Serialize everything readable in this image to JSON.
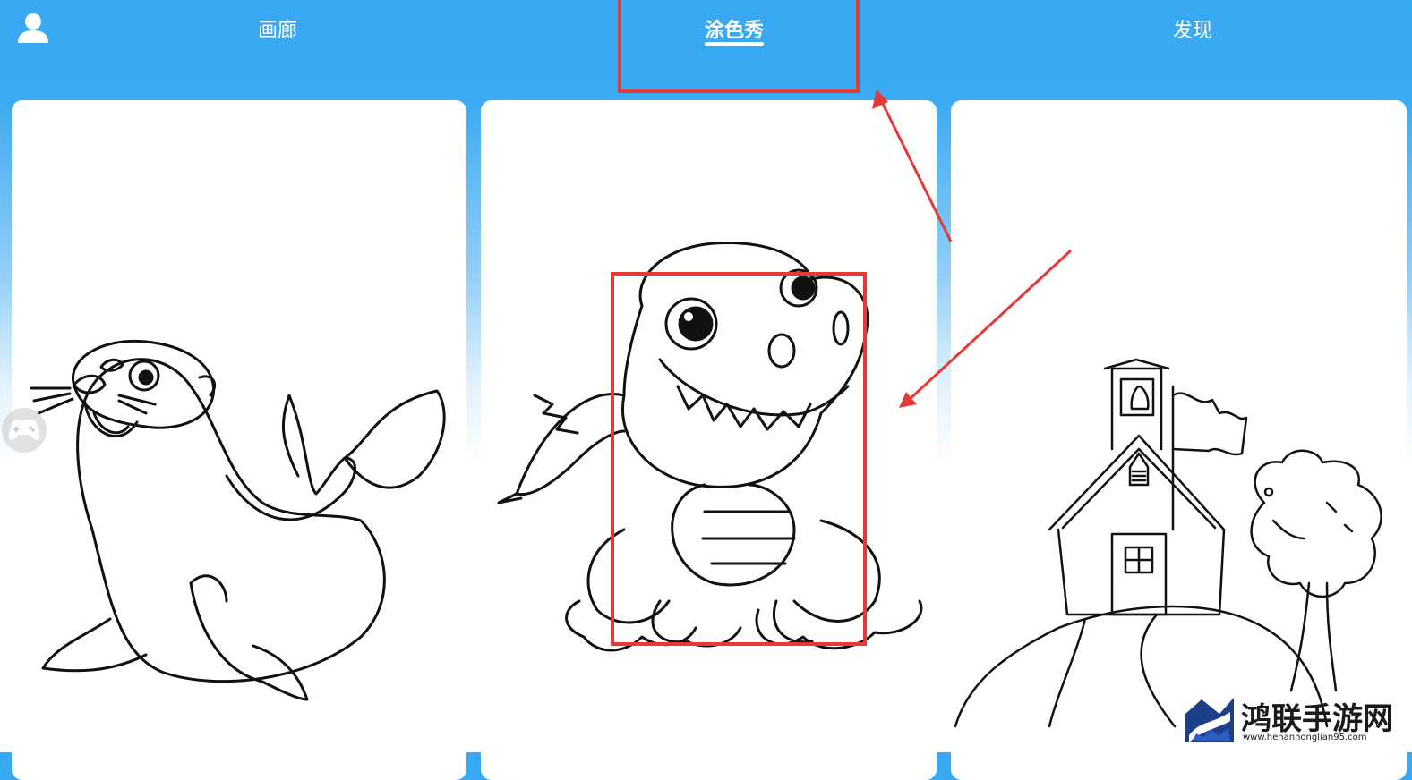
{
  "header": {
    "tabs": [
      {
        "label": "画廊",
        "active": false
      },
      {
        "label": "涂色秀",
        "active": true
      },
      {
        "label": "发现",
        "active": false
      }
    ]
  },
  "cards": [
    {
      "subject": "seal"
    },
    {
      "subject": "dinosaur"
    },
    {
      "subject": "schoolhouse"
    }
  ],
  "watermark": {
    "text": "鸿联手游网",
    "url": "www.henanhonglian95.com"
  },
  "colors": {
    "header_blue": "#37a8f2",
    "highlight_red": "#e53935",
    "card_white": "#ffffff"
  },
  "icons": [
    "user-icon",
    "gamepad-icon",
    "watermark-logo-icon"
  ]
}
